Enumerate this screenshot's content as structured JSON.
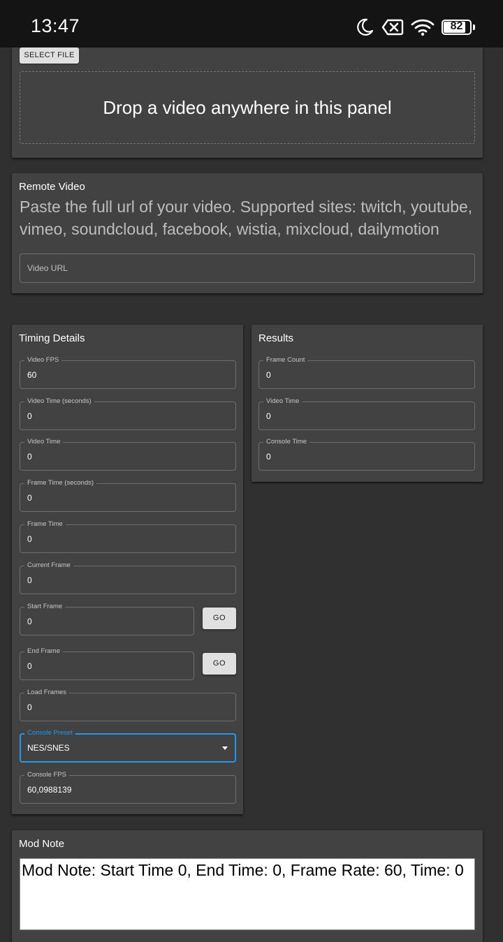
{
  "status_bar": {
    "time": "13:47",
    "battery_level": "82",
    "icons": [
      "moon-icon",
      "data-off-icon",
      "wifi-icon",
      "battery-icon"
    ]
  },
  "local_video": {
    "select_file_label": "SELECT FILE",
    "drop_text": "Drop a video anywhere in this panel"
  },
  "remote_video": {
    "title": "Remote Video",
    "helper": "Paste the full url of your video. Supported sites: twitch, youtube, vimeo, soundcloud, facebook, wistia, mixcloud, dailymotion",
    "url_placeholder": "Video URL"
  },
  "timing": {
    "title": "Timing Details",
    "fields": {
      "video_fps": {
        "label": "Video FPS",
        "value": "60"
      },
      "video_time_seconds": {
        "label": "Video Time (seconds)",
        "value": "0"
      },
      "video_time": {
        "label": "Video Time",
        "value": "0"
      },
      "frame_time_seconds": {
        "label": "Frame Time (seconds)",
        "value": "0"
      },
      "frame_time": {
        "label": "Frame Time",
        "value": "0"
      },
      "current_frame": {
        "label": "Current Frame",
        "value": "0"
      },
      "start_frame": {
        "label": "Start Frame",
        "value": "0"
      },
      "end_frame": {
        "label": "End Frame",
        "value": "0"
      },
      "load_frames": {
        "label": "Load Frames",
        "value": "0"
      },
      "console_preset": {
        "label": "Console Preset",
        "value": "NES/SNES"
      },
      "console_fps": {
        "label": "Console FPS",
        "value": "60,0988139"
      }
    },
    "go_label": "GO"
  },
  "results": {
    "title": "Results",
    "fields": {
      "frame_count": {
        "label": "Frame Count",
        "value": "0"
      },
      "video_time": {
        "label": "Video Time",
        "value": "0"
      },
      "console_time": {
        "label": "Console Time",
        "value": "0"
      }
    }
  },
  "mod_note": {
    "title": "Mod Note",
    "text": "Mod Note: Start Time 0, End Time: 0, Frame Rate: 60, Time: 0"
  },
  "colors": {
    "background": "#303030",
    "panel": "#424242",
    "status_bar": "#141414",
    "accent": "#2196f3"
  }
}
